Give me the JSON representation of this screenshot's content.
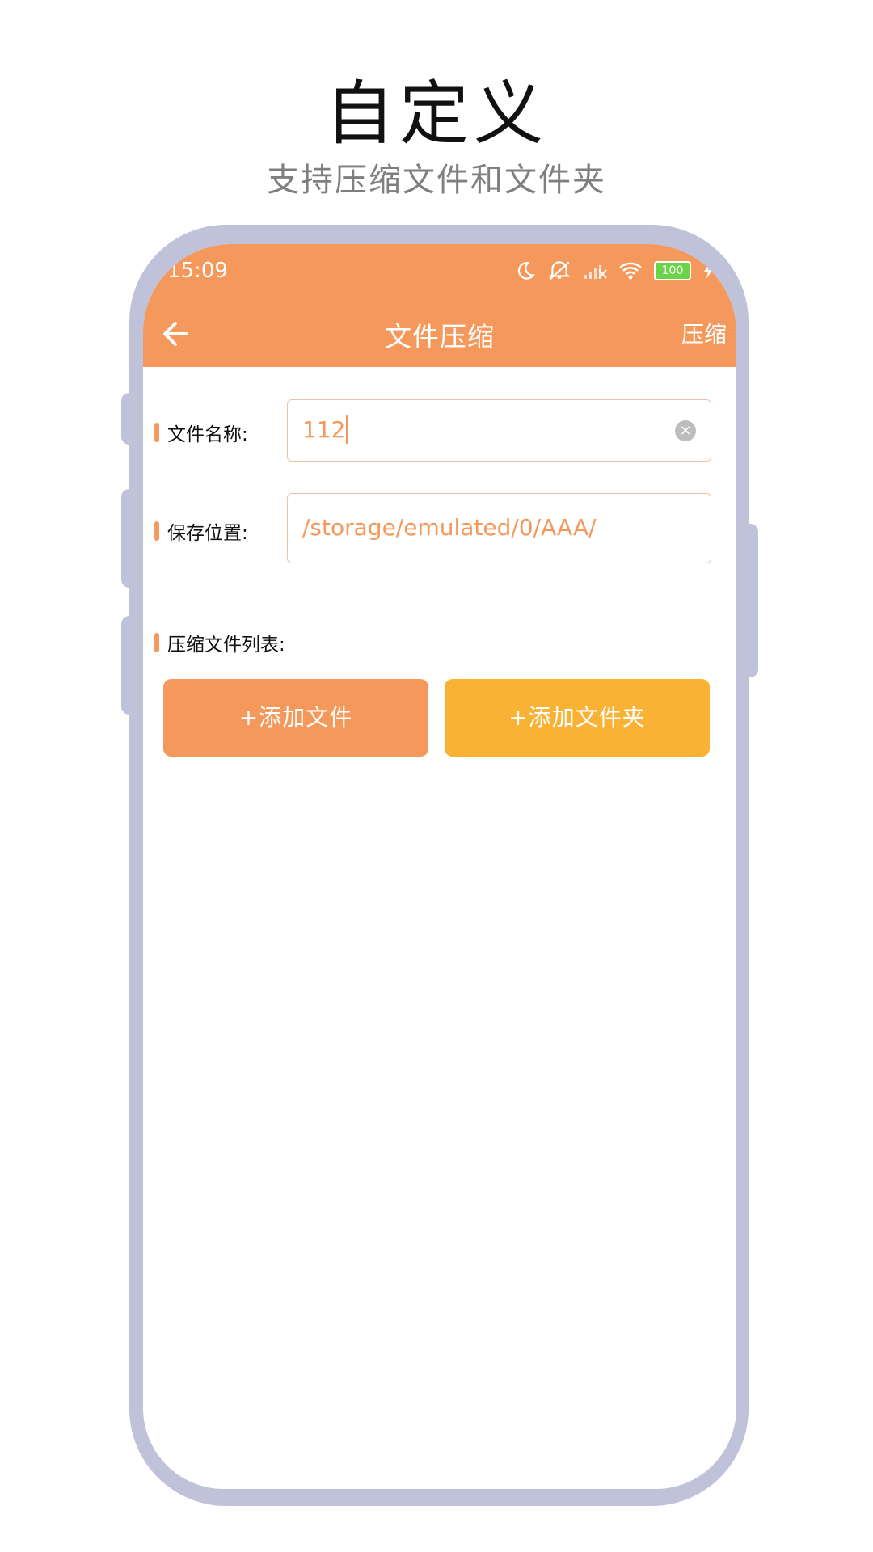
{
  "promo": {
    "title": "自定义",
    "subtitle": "支持压缩文件和文件夹"
  },
  "statusbar": {
    "time": "15:09",
    "icons": [
      "moon-icon",
      "mute-icon",
      "signal-icon",
      "wifi-icon",
      "battery-icon",
      "charging-icon"
    ],
    "battery": "100"
  },
  "toolbar": {
    "back_icon": "arrow-left-icon",
    "title": "文件压缩",
    "action": "压缩"
  },
  "form": {
    "name_label": "文件名称:",
    "name_value": "112",
    "location_label": "保存位置:",
    "location_value": "/storage/emulated/0/AAA/",
    "list_label": "压缩文件列表:"
  },
  "buttons": {
    "add_file": "+添加文件",
    "add_folder": "+添加文件夹"
  },
  "colors": {
    "accent": "#f5985b",
    "accent_secondary": "#f9b233",
    "phone_frame": "#bfc2d9"
  }
}
